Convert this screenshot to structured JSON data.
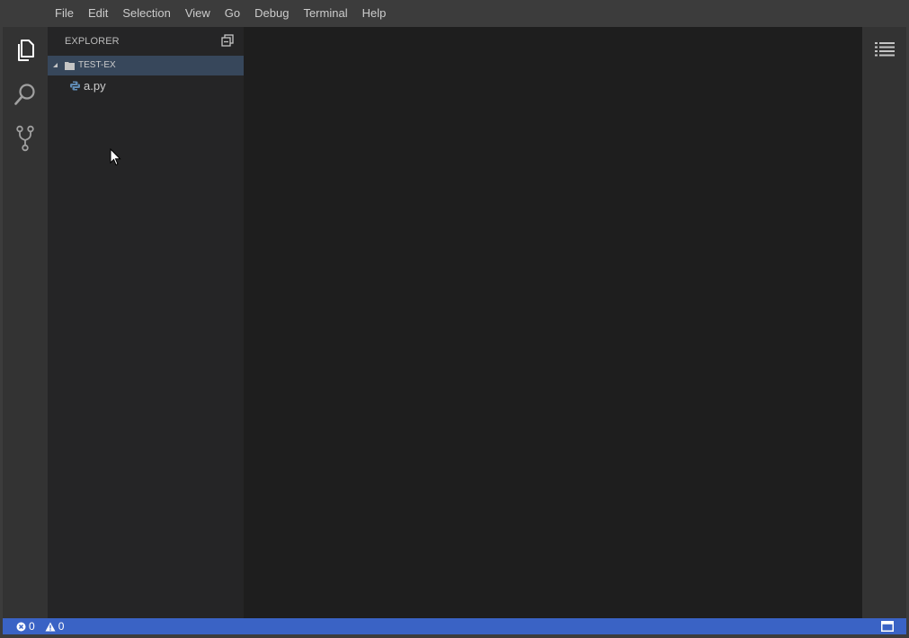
{
  "menu": {
    "items": [
      "File",
      "Edit",
      "Selection",
      "View",
      "Go",
      "Debug",
      "Terminal",
      "Help"
    ]
  },
  "activity_bar": {
    "items": [
      {
        "icon": "files-icon"
      },
      {
        "icon": "search-icon"
      },
      {
        "icon": "source-control-icon"
      }
    ]
  },
  "sidebar": {
    "title": "EXPLORER",
    "collapse_icon": "collapse-all-icon",
    "folder": {
      "name": "TEST-EX",
      "expanded": true
    },
    "files": [
      {
        "name": "a.py",
        "icon": "python-file-icon"
      }
    ]
  },
  "right_panel": {
    "icon": "outline-list-icon"
  },
  "status": {
    "errors": "0",
    "warnings": "0",
    "panel_icon": "panel-toggle-icon"
  },
  "colors": {
    "menubar": "#3c3c3c",
    "activitybar": "#333333",
    "sidebar": "#252526",
    "selected_row": "#37475b",
    "editor": "#1e1e1e",
    "statusbar": "#3a63c5"
  }
}
